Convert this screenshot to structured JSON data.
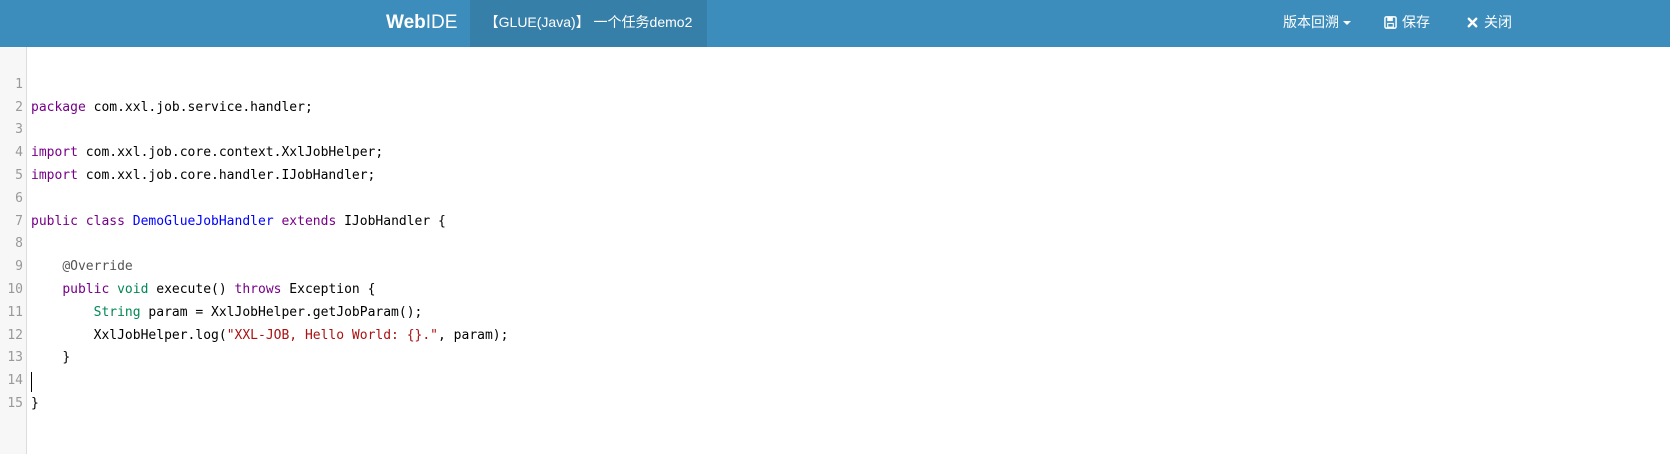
{
  "navbar": {
    "brand_bold": "Web",
    "brand_rest": "IDE",
    "task_title": "【GLUE(Java)】 一个任务demo2",
    "version_label": "版本回溯",
    "save_label": "保存",
    "close_label": "关闭",
    "background_color": "#3c8dbc",
    "tab_color": "#367fa9"
  },
  "editor": {
    "lines": [
      {
        "n": "1"
      },
      {
        "n": "2"
      },
      {
        "n": "3"
      },
      {
        "n": "4"
      },
      {
        "n": "5"
      },
      {
        "n": "6"
      },
      {
        "n": "7"
      },
      {
        "n": "8"
      },
      {
        "n": "9"
      },
      {
        "n": "10"
      },
      {
        "n": "11"
      },
      {
        "n": "12"
      },
      {
        "n": "13"
      },
      {
        "n": "14"
      },
      {
        "n": "15"
      }
    ],
    "code": {
      "l1_kw": "package",
      "l1_rest": " com.xxl.job.service.handler;",
      "l3_kw": "import",
      "l3_rest": " com.xxl.job.core.context.XxlJobHelper;",
      "l4_kw": "import",
      "l4_rest": " com.xxl.job.core.handler.IJobHandler;",
      "l6_kw1": "public",
      "l6_kw2": "class",
      "l6_def": "DemoGlueJobHandler",
      "l6_kw3": "extends",
      "l6_rest": " IJobHandler {",
      "l8_meta": "@Override",
      "l9_kw1": "public",
      "l9_ty": "void",
      "l9_mid": " execute() ",
      "l9_kw2": "throws",
      "l9_rest": " Exception {",
      "l10_ty": "String",
      "l10_rest": " param = XxlJobHelper.getJobParam();",
      "l11_pre": "XxlJobHelper.log(",
      "l11_str": "\"XXL-JOB, Hello World: {}.\"",
      "l11_rest": ", param);",
      "l12": "}",
      "l14": "}"
    },
    "colors": {
      "keyword": "#770088",
      "definition": "#0000ff",
      "type": "#008855",
      "string": "#aa1111",
      "annotation": "#555555",
      "line_number": "#999999"
    }
  }
}
